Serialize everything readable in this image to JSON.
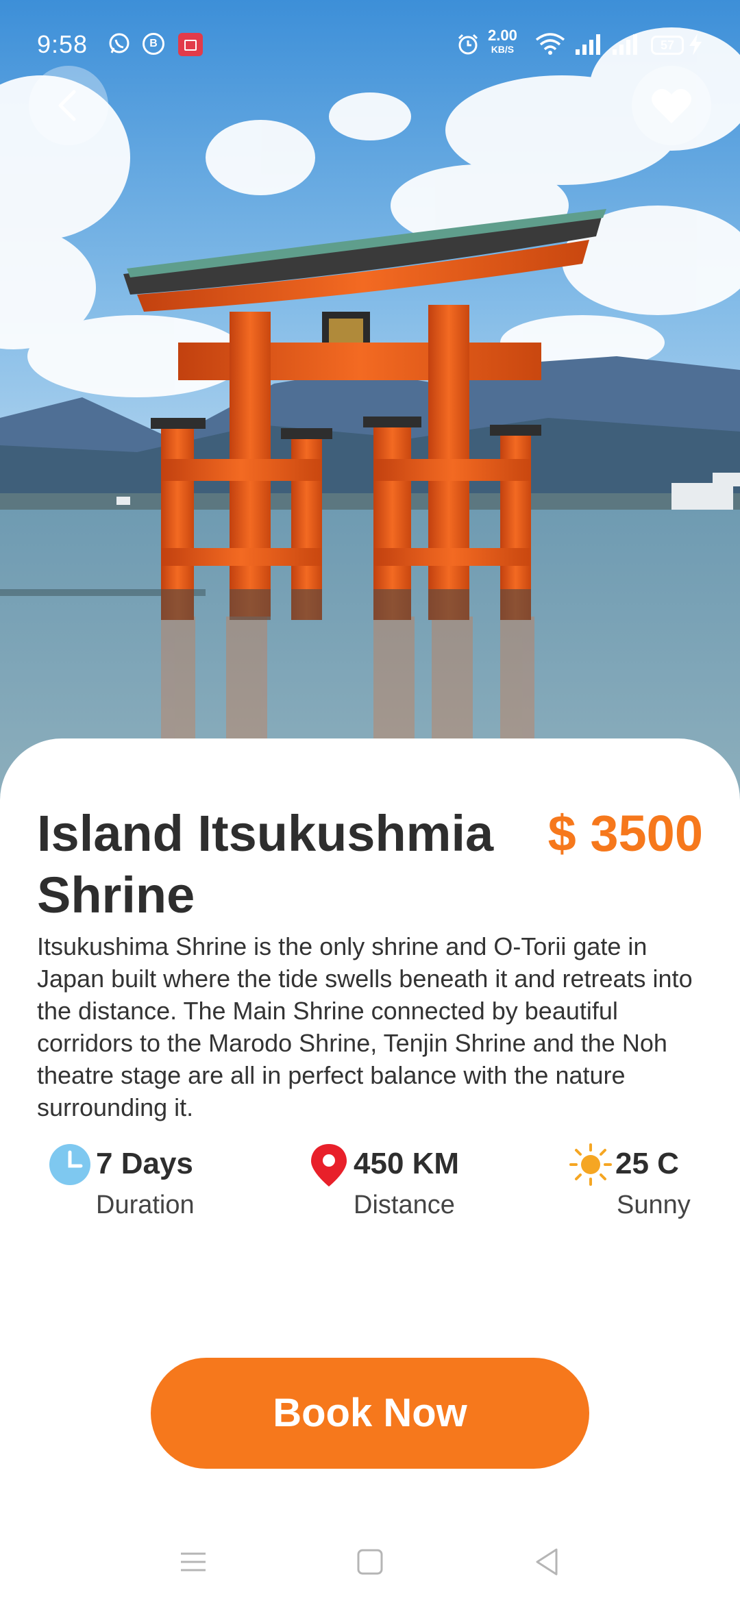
{
  "status_bar": {
    "time": "9:58",
    "net_speed_value": "2.00",
    "net_speed_unit": "KB/S",
    "battery": "57",
    "app_icons": [
      "whatsapp-icon",
      "b-app-icon",
      "screen-recorder-icon"
    ],
    "app_b_label": "B"
  },
  "destination": {
    "title": "Island Itsukushmia Shrine",
    "price": "$ 3500",
    "description": "Itsukushima Shrine is the only shrine and O-Torii gate in Japan built where the tide swells beneath it and retreats into the distance. The Main Shrine connected by beautiful corridors to the Marodo Shrine, Tenjin Shrine and the Noh theatre stage are all in perfect balance with the nature surrounding it."
  },
  "stats": {
    "duration": {
      "value": "7 Days",
      "label": "Duration",
      "icon": "clock-icon"
    },
    "distance": {
      "value": "450 KM",
      "label": "Distance",
      "icon": "location-pin-icon"
    },
    "weather": {
      "value": "25 C",
      "label": "Sunny",
      "icon": "sun-icon"
    }
  },
  "actions": {
    "book_label": "Book Now"
  },
  "colors": {
    "accent": "#f6781c",
    "title_text": "#2e2e2e",
    "clock_blue": "#7ec8f0",
    "pin_red": "#e8202a",
    "sun_orange": "#f5a623"
  }
}
